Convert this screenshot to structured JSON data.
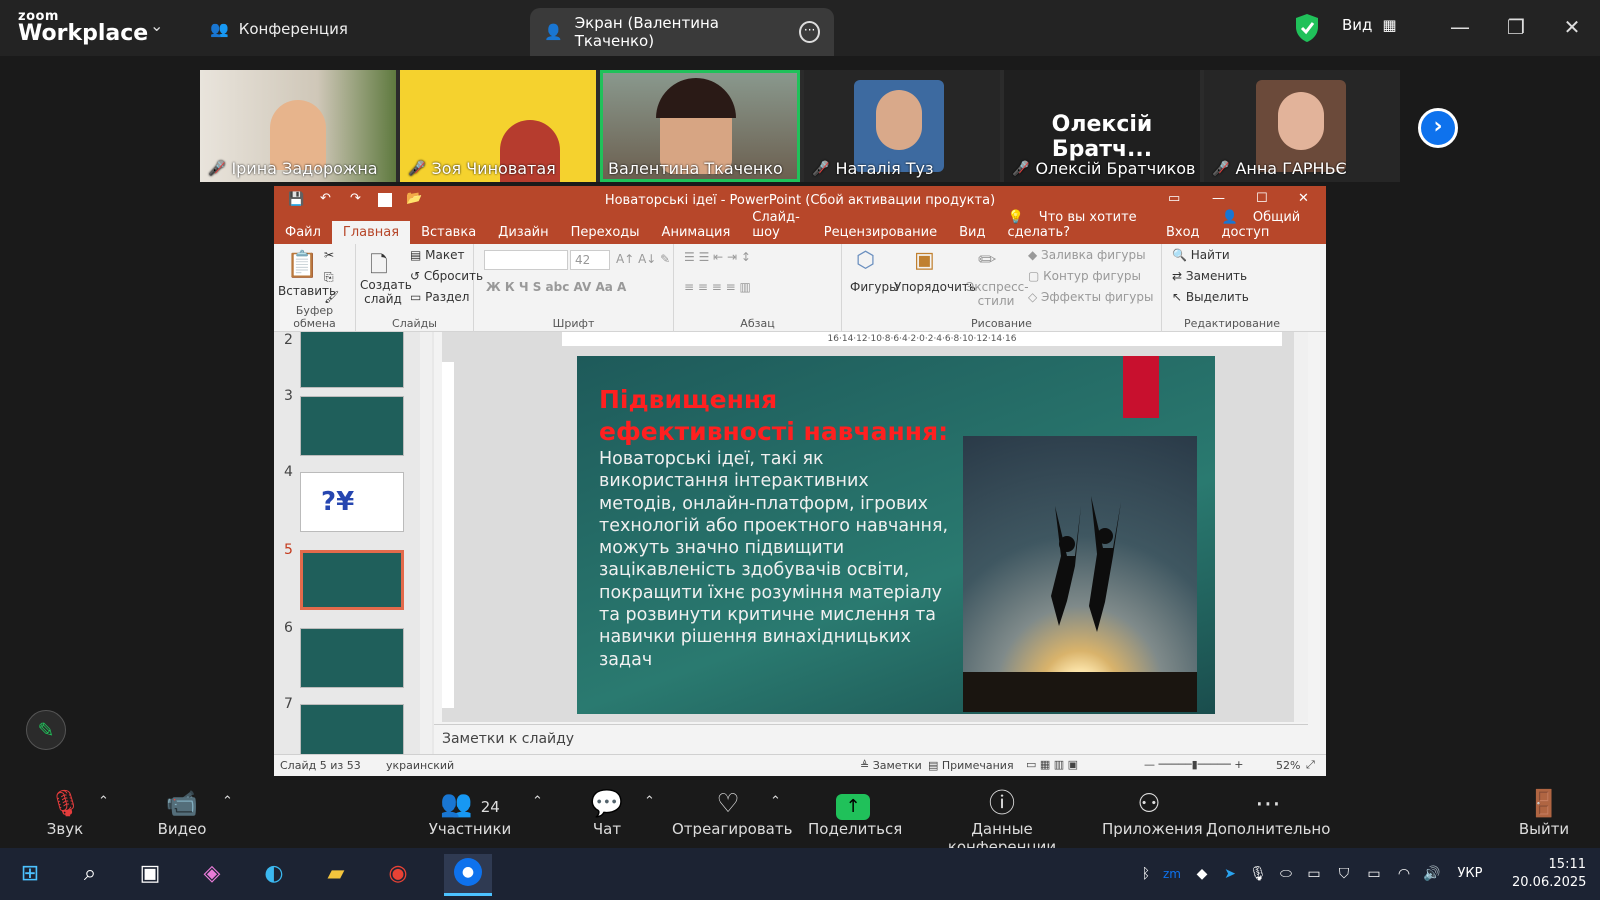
{
  "zoom": {
    "logo_line1": "zoom",
    "logo_line2": "Workplace",
    "conference_tab": "Конференция",
    "share_tab": "Экран (Валентина Ткаченко)",
    "view_label": "Вид"
  },
  "participants": [
    {
      "name": "Ірина Задорожна",
      "muted": true,
      "bg": "#d9d2c4"
    },
    {
      "name": "Зоя Чиноватая",
      "muted": true,
      "bg": "#f5d22e"
    },
    {
      "name": "Валентина Ткаченко",
      "muted": false,
      "bg": "#7a6a55"
    },
    {
      "name": "Наталія Туз",
      "muted": true,
      "bg": "#2a2a2a"
    },
    {
      "name": "Олексій Братчиков",
      "muted": true,
      "bg": "#1f1f1f",
      "big": "Олексій Братч..."
    },
    {
      "name": "Анна ГАРНЬЄ",
      "muted": true,
      "bg": "#2a2a2a"
    }
  ],
  "ppt": {
    "title": "Новаторські ідеї - PowerPoint (Сбой активации продукта)",
    "tabs": [
      "Файл",
      "Главная",
      "Вставка",
      "Дизайн",
      "Переходы",
      "Анимация",
      "Слайд-шоу",
      "Рецензирование",
      "Вид"
    ],
    "tell_me": "Что вы хотите сделать?",
    "signin": "Вход",
    "share": "Общий доступ",
    "ribbon": {
      "paste": "Вставить",
      "clipboard": "Буфер обмена",
      "new_slide": "Создать слайд",
      "layout": "Макет",
      "reset": "Сбросить",
      "section": "Раздел",
      "slides": "Слайды",
      "font_size": "42",
      "font": "Шрифт",
      "paragraph": "Абзац",
      "shapes": "Фигуры",
      "arrange": "Упорядочить",
      "quick_styles": "Экспресс-стили",
      "shape_fill": "Заливка фигуры",
      "shape_outline": "Контур фигуры",
      "shape_effects": "Эффекты фигуры",
      "drawing": "Рисование",
      "find": "Найти",
      "replace": "Заменить",
      "select": "Выделить",
      "editing": "Редактирование"
    },
    "thumb_numbers": [
      "2",
      "3",
      "4",
      "5",
      "6",
      "7"
    ],
    "slide": {
      "title": "Підвищення ефективності навчання:",
      "body": "Новаторські ідеї, такі як використання інтерактивних методів, онлайн-платформ, ігрових технологій або проектного навчання, можуть значно підвищити зацікавленість здобувачів освіти, покращити їхнє розуміння матеріалу та розвинути критичне мислення та навички рішення винахідницьких задач"
    },
    "notes_placeholder": "Заметки к слайду",
    "status": {
      "slide": "Слайд 5 из 53",
      "lang": "украинский",
      "notes": "Заметки",
      "comments": "Примечания",
      "zoom": "52%"
    }
  },
  "toolbar": {
    "audio": "Звук",
    "video": "Видео",
    "participants": "Участники",
    "participants_count": "24",
    "chat": "Чат",
    "react": "Отреагировать",
    "share": "Поделиться",
    "info": "Данные конференции",
    "apps": "Приложения",
    "more": "Дополнительно",
    "leave": "Выйти"
  },
  "taskbar": {
    "lang": "УКР",
    "time": "15:11",
    "date": "20.06.2025"
  },
  "colors": {
    "ppt_accent": "#b7472a",
    "zoom_share": "#20c15a",
    "zoom_blue": "#0e72ed"
  }
}
